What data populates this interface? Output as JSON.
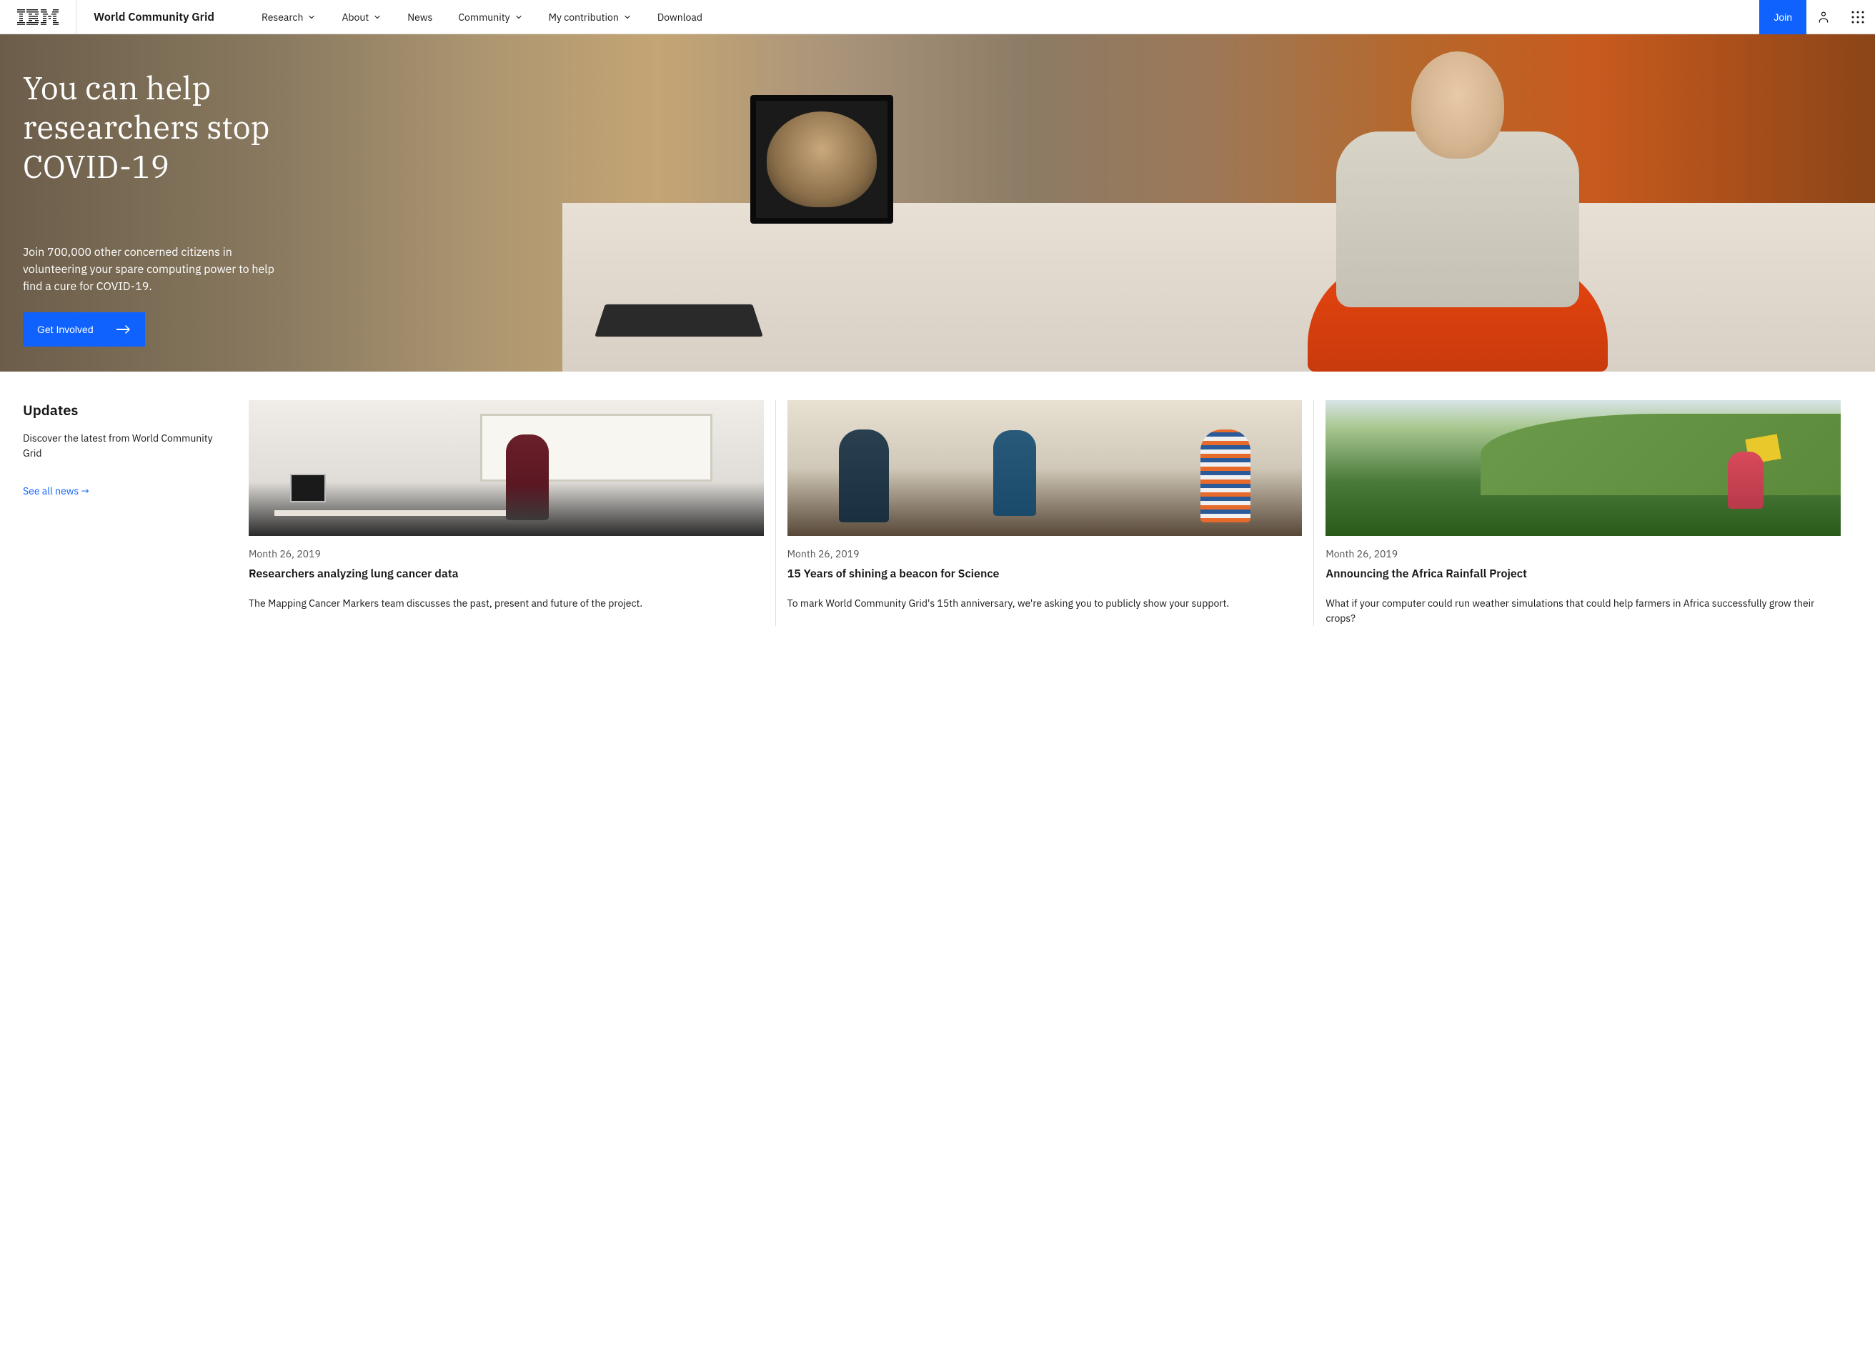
{
  "header": {
    "site_name": "World Community Grid",
    "nav": [
      {
        "label": "Research",
        "dropdown": true
      },
      {
        "label": "About",
        "dropdown": true
      },
      {
        "label": "News",
        "dropdown": false
      },
      {
        "label": "Community",
        "dropdown": true
      },
      {
        "label": "My contribution",
        "dropdown": true
      },
      {
        "label": "Download",
        "dropdown": false
      }
    ],
    "join_label": "Join"
  },
  "hero": {
    "title": "You can help researchers stop COVID-19",
    "subtitle": "Join 700,000 other concerned citizens in volunteering your spare computing power to help find a cure for COVID-19.",
    "cta_label": "Get Involved"
  },
  "updates": {
    "heading": "Updates",
    "description": "Discover the latest from World Community Grid",
    "see_all_label": "See all news →",
    "cards": [
      {
        "date": "Month 26, 2019",
        "title": "Researchers analyzing lung cancer data",
        "description": "The Mapping Cancer Markers team discusses the past, present and future of the project."
      },
      {
        "date": "Month 26, 2019",
        "title": "15 Years of shining a beacon for Science",
        "description": "To mark World Community Grid's 15th anniversary, we're asking you to publicly show your support."
      },
      {
        "date": "Month 26, 2019",
        "title": "Announcing the Africa Rainfall Project",
        "description": "What if your computer could run weather simulations that could help farmers in Africa successfully grow their crops?"
      }
    ]
  },
  "colors": {
    "primary": "#0f62fe",
    "text": "#161616"
  }
}
